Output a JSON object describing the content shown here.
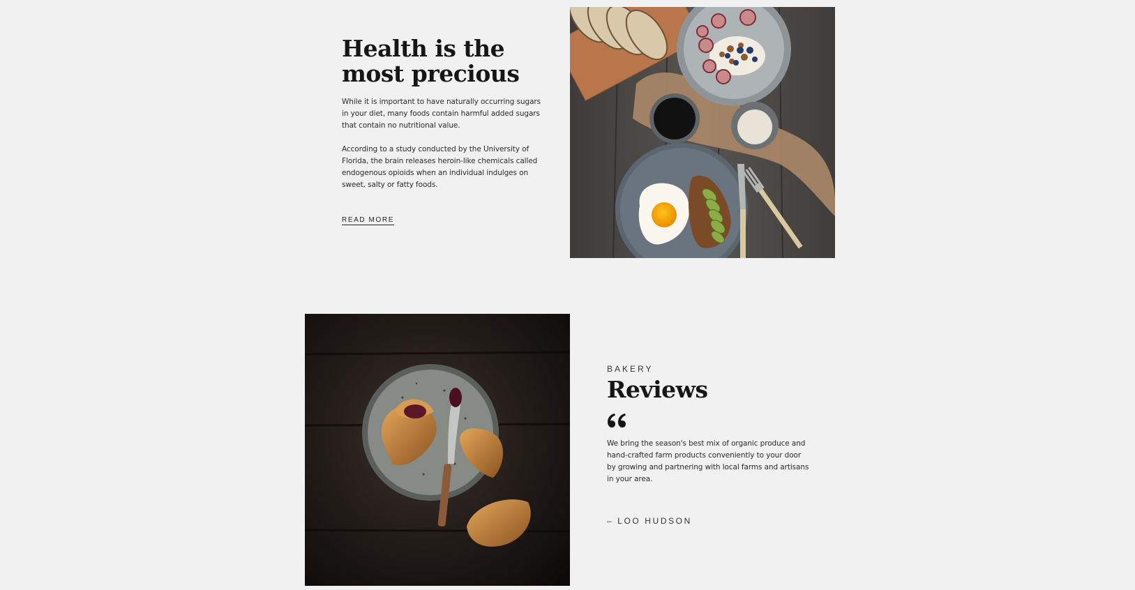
{
  "health": {
    "title": "Health is the most precious",
    "paragraphs": [
      "While it is important to have naturally occurring sugars in your diet, many foods contain harmful added sugars that contain no nutritional value.",
      "According to a study conducted by the University of Florida, the brain releases heroin-like chemicals called endogenous opioids when an individual indulges on sweet, salty or fatty foods."
    ],
    "read_more_label": "READ MORE",
    "image_icon": "breakfast-photo"
  },
  "reviews": {
    "eyebrow": "BAKERY",
    "title": "Reviews",
    "quote_icon": "quote-icon",
    "quote": "We bring the season's best mix of organic produce and hand-crafted farm products conveniently to your door by growing and partnering with local farms and artisans in your area.",
    "author": "– LOO HUDSON",
    "image_icon": "croissant-photo"
  },
  "colors": {
    "background": "#f1f1f1",
    "text": "#1a1a1a",
    "dark_wood": "#1b1614",
    "grey_wood": "#4a4846"
  }
}
